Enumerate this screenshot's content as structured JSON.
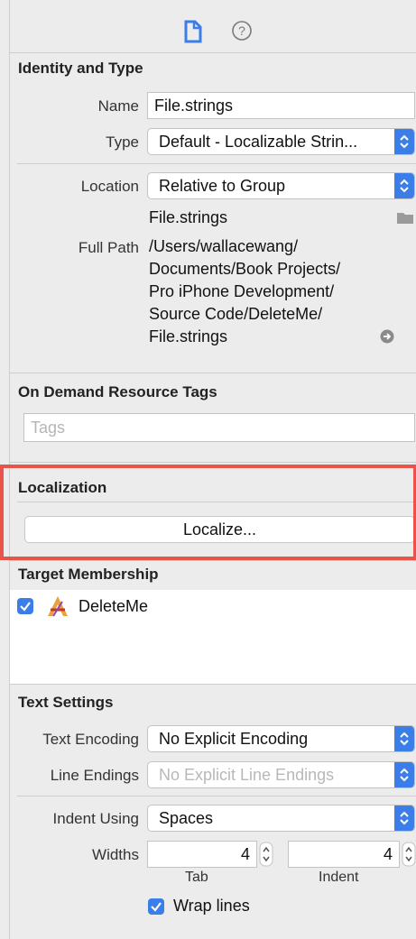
{
  "identity": {
    "header": "Identity and Type",
    "name_label": "Name",
    "name_value": "File.strings",
    "type_label": "Type",
    "type_value": "Default - Localizable Strin...",
    "location_label": "Location",
    "location_value": "Relative to Group",
    "file_name": "File.strings",
    "full_path_label": "Full Path",
    "full_path_lines": [
      "/Users/wallacewang/",
      "Documents/Book Projects/",
      "Pro iPhone Development/",
      "Source Code/DeleteMe/",
      "File.strings"
    ]
  },
  "odr": {
    "header": "On Demand Resource Tags",
    "tags_placeholder": "Tags"
  },
  "localization": {
    "header": "Localization",
    "button_label": "Localize..."
  },
  "target": {
    "header": "Target Membership",
    "items": [
      {
        "name": "DeleteMe",
        "checked": true
      }
    ]
  },
  "text_settings": {
    "header": "Text Settings",
    "encoding_label": "Text Encoding",
    "encoding_value": "No Explicit Encoding",
    "line_endings_label": "Line Endings",
    "line_endings_value": "No Explicit Line Endings",
    "indent_label": "Indent Using",
    "indent_value": "Spaces",
    "widths_label": "Widths",
    "tab_value": "4",
    "tab_caption": "Tab",
    "indent_width_value": "4",
    "indent_caption": "Indent",
    "wrap_label": "Wrap lines",
    "wrap_checked": true
  },
  "colors": {
    "accent": "#3b7ee8",
    "highlight_border": "#e8534a"
  }
}
